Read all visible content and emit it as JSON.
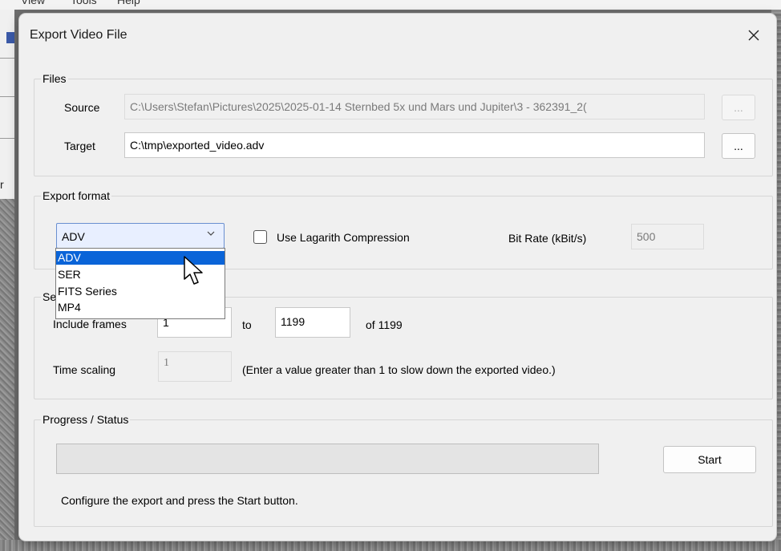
{
  "background_app": {
    "menu": [
      "View",
      "Tools",
      "Help"
    ],
    "left_glyph": "r"
  },
  "dialog": {
    "title": "Export Video File",
    "close_icon": "close-icon"
  },
  "files": {
    "legend": "Files",
    "source_label": "Source",
    "source_value": "C:\\Users\\Stefan\\Pictures\\2025\\2025-01-14 Sternbed 5x und Mars und Jupiter\\3 - 362391_2(",
    "source_browse": "...",
    "target_label": "Target",
    "target_value": "C:\\tmp\\exported_video.adv",
    "target_browse": "..."
  },
  "export_format": {
    "legend": "Export format",
    "selected": "ADV",
    "options": [
      "ADV",
      "SER",
      "FITS Series",
      "MP4"
    ],
    "lagarith_label": "Use Lagarith Compression",
    "lagarith_checked": false,
    "bitrate_label": "Bit Rate (kBit/s)",
    "bitrate_value": "500"
  },
  "selection": {
    "legend_visible": "Se",
    "include_label": "Include frames",
    "from_value": "1",
    "to_label": "to",
    "to_value": "1199",
    "of_label": "of 1199",
    "time_scaling_label": "Time scaling",
    "time_scaling_value": "1",
    "time_scaling_hint": "(Enter a value greater than 1 to slow down the exported video.)"
  },
  "progress": {
    "legend": "Progress / Status",
    "percent": 0,
    "start_label": "Start",
    "status_text": "Configure the export and press the Start button."
  },
  "colors": {
    "selection_highlight": "#0a64d8",
    "combo_focus": "#e8efff"
  }
}
